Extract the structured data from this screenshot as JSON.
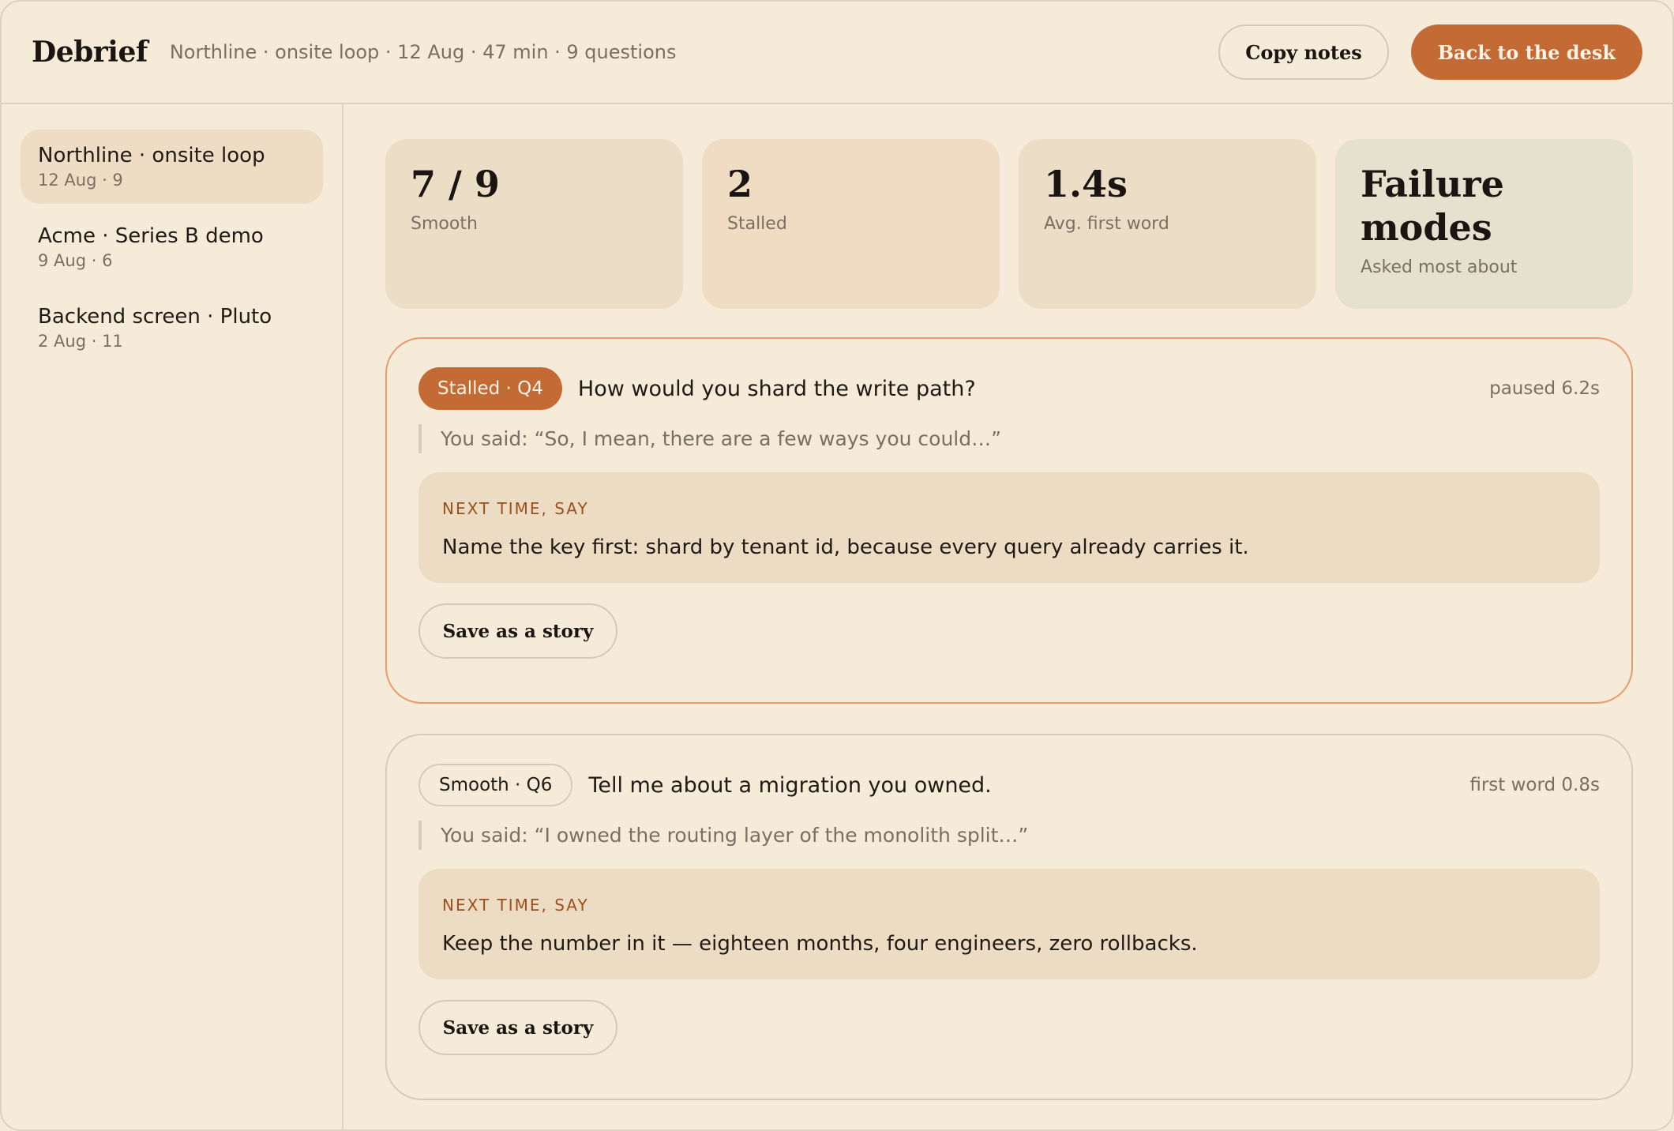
{
  "header": {
    "brand": "Debrief",
    "meta": "Northline · onsite loop · 12 Aug · 47 min · 9 questions",
    "copy_label": "Copy notes",
    "back_label": "Back to the desk"
  },
  "sidebar": {
    "items": [
      {
        "title": "Northline · onsite loop",
        "sub": "12 Aug · 9",
        "active": true
      },
      {
        "title": "Acme · Series B demo",
        "sub": "9 Aug · 6",
        "active": false
      },
      {
        "title": "Backend screen · Pluto",
        "sub": "2 Aug · 11",
        "active": false
      }
    ]
  },
  "stats": [
    {
      "value": "7 / 9",
      "label": "Smooth"
    },
    {
      "value": "2",
      "label": "Stalled"
    },
    {
      "value": "1.4s",
      "label": "Avg. first word"
    },
    {
      "value": "Failure modes",
      "label": "Asked most about"
    }
  ],
  "cards": [
    {
      "tag": "Stalled · Q4",
      "question": "How would you shard the write path?",
      "meta": "paused 6.2s",
      "quote": "You said: “So, I mean, there are a few ways you could…”",
      "advice_label": "NEXT TIME, SAY",
      "advice": "Name the key first: shard by tenant id, because every query already carries it.",
      "button": "Save as a story"
    },
    {
      "tag": "Smooth · Q6",
      "question": "Tell me about a migration you owned.",
      "meta": "first word 0.8s",
      "quote": "You said: “I owned the routing layer of the monolith split…”",
      "advice_label": "NEXT TIME, SAY",
      "advice": "Keep the number in it — eighteen months, four engineers, zero rollbacks.",
      "button": "Save as a story"
    }
  ],
  "colors": {
    "accent": "#c46b35",
    "background": "#f6ead8",
    "card_stalled_border": "#e89a6a"
  }
}
